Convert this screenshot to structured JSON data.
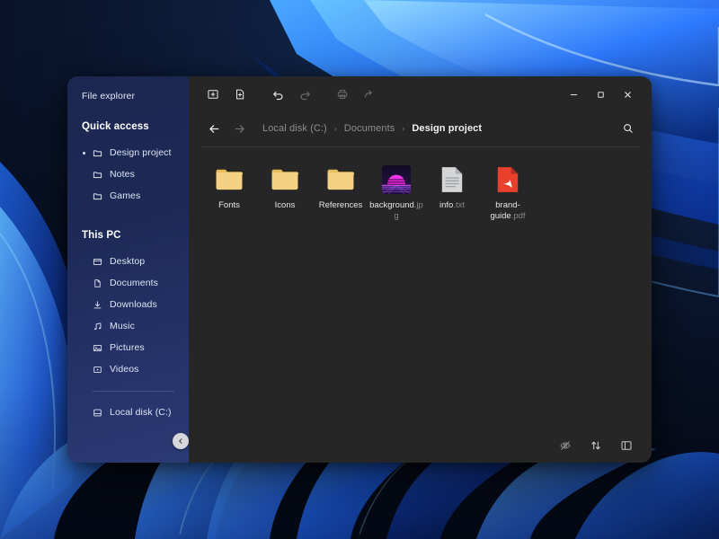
{
  "window": {
    "app_title": "File explorer",
    "controls": {
      "minimize": "minimize",
      "maximize": "maximize",
      "close": "close"
    }
  },
  "sidebar": {
    "title": "File explorer",
    "groups": [
      {
        "label": "Quick access",
        "items": [
          {
            "label": "Design project",
            "icon": "folder-icon",
            "selected": true
          },
          {
            "label": "Notes",
            "icon": "folder-icon",
            "selected": false
          },
          {
            "label": "Games",
            "icon": "folder-icon",
            "selected": false
          }
        ]
      },
      {
        "label": "This PC",
        "items": [
          {
            "label": "Desktop",
            "icon": "desktop-icon"
          },
          {
            "label": "Documents",
            "icon": "document-icon"
          },
          {
            "label": "Downloads",
            "icon": "download-icon"
          },
          {
            "label": "Music",
            "icon": "music-note-icon"
          },
          {
            "label": "Pictures",
            "icon": "picture-icon"
          },
          {
            "label": "Videos",
            "icon": "video-icon"
          }
        ]
      }
    ],
    "drives": [
      {
        "label": "Local disk (C:)",
        "icon": "drive-icon"
      }
    ],
    "collapse_button": "collapse-sidebar"
  },
  "toolbar": {
    "buttons": [
      {
        "name": "new-folder-button",
        "icon": "new-folder-icon",
        "enabled": true
      },
      {
        "name": "new-file-button",
        "icon": "new-file-icon",
        "enabled": true
      },
      {
        "name": "undo-button",
        "icon": "undo-icon",
        "enabled": true
      },
      {
        "name": "redo-button",
        "icon": "redo-icon",
        "enabled": false
      },
      {
        "name": "print-button",
        "icon": "print-icon",
        "enabled": false
      },
      {
        "name": "share-button",
        "icon": "share-icon",
        "enabled": false
      }
    ]
  },
  "navigation": {
    "back": "back-arrow",
    "forward": "forward-arrow",
    "search": "search-icon",
    "breadcrumb": [
      {
        "label": "Local disk (C:)",
        "current": false
      },
      {
        "label": "Documents",
        "current": false
      },
      {
        "label": "Design project",
        "current": true
      }
    ],
    "separator": "›"
  },
  "files": [
    {
      "name": "Fonts",
      "ext": "",
      "type": "folder"
    },
    {
      "name": "Icons",
      "ext": "",
      "type": "folder"
    },
    {
      "name": "References",
      "ext": "",
      "type": "folder"
    },
    {
      "name": "background",
      "ext": ".jpg",
      "type": "image"
    },
    {
      "name": "info",
      "ext": ".txt",
      "type": "text"
    },
    {
      "name": "brand-guide",
      "ext": ".pdf",
      "type": "pdf"
    }
  ],
  "statusbar": {
    "buttons": [
      {
        "name": "hidden-items-button",
        "icon": "eye-off-icon"
      },
      {
        "name": "sort-button",
        "icon": "sort-arrows-icon"
      },
      {
        "name": "layout-pane-button",
        "icon": "layout-pane-icon"
      }
    ]
  },
  "colors": {
    "window_bg": "#262626",
    "sidebar_start": "#1b2750",
    "sidebar_end": "#2b3a74",
    "folder_yellow": "#f2d07a",
    "pdf_red": "#e8402a",
    "accent_blue": "#2b6fe3"
  }
}
